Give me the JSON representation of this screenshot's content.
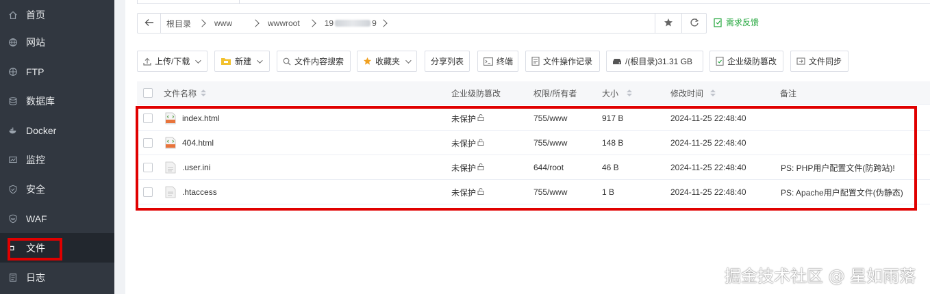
{
  "sidebar": {
    "items": [
      {
        "label": "首页",
        "icon": "home-icon"
      },
      {
        "label": "网站",
        "icon": "globe-icon"
      },
      {
        "label": "FTP",
        "icon": "ftp-icon"
      },
      {
        "label": "数据库",
        "icon": "database-icon"
      },
      {
        "label": "Docker",
        "icon": "docker-icon"
      },
      {
        "label": "监控",
        "icon": "monitor-icon"
      },
      {
        "label": "安全",
        "icon": "shield-icon"
      },
      {
        "label": "WAF",
        "icon": "waf-shield-icon"
      },
      {
        "label": "文件",
        "icon": "folder-icon",
        "active": true
      },
      {
        "label": "日志",
        "icon": "log-icon"
      }
    ]
  },
  "pathbar": {
    "crumbs": [
      "根目录",
      "www",
      "wwwroot",
      "19"
    ],
    "last_crumb_suffix": "9"
  },
  "feedback": {
    "label": "需求反馈"
  },
  "toolbar": {
    "upload": "上传/下载",
    "new": "新建",
    "search_content": "文件内容搜索",
    "favorites": "收藏夹",
    "share_list": "分享列表",
    "terminal": "终端",
    "file_log": "文件操作记录",
    "disk": "/(根目录)31.31 GB",
    "tamper": "企业级防篡改",
    "sync": "文件同步"
  },
  "table": {
    "headers": {
      "name": "文件名称",
      "tamper": "企业级防篡改",
      "perm": "权限/所有者",
      "size": "大小",
      "mtime": "修改时间",
      "note": "备注"
    },
    "rows": [
      {
        "name": "index.html",
        "type": "html",
        "tamper": "未保护",
        "perm": "755/www",
        "size": "917 B",
        "mtime": "2024-11-25 22:48:40",
        "note": ""
      },
      {
        "name": "404.html",
        "type": "html",
        "tamper": "未保护",
        "perm": "755/www",
        "size": "148 B",
        "mtime": "2024-11-25 22:48:40",
        "note": ""
      },
      {
        "name": ".user.ini",
        "type": "file",
        "tamper": "未保护",
        "perm": "644/root",
        "size": "46 B",
        "mtime": "2024-11-25 22:48:40",
        "note": "PS: PHP用户配置文件(防跨站)!"
      },
      {
        "name": ".htaccess",
        "type": "file",
        "tamper": "未保护",
        "perm": "755/www",
        "size": "1 B",
        "mtime": "2024-11-25 22:48:40",
        "note": "PS: Apache用户配置文件(伪静态)"
      }
    ]
  },
  "watermark": "掘金技术社区 @ 星如雨落",
  "colors": {
    "sidebar_bg": "#313740",
    "accent_green": "#20a53a",
    "highlight_red": "#e00000"
  }
}
